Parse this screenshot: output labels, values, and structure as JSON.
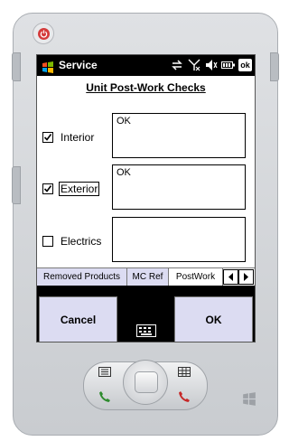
{
  "status_bar": {
    "app_title": "Service",
    "icons": [
      "windows-start-icon",
      "sync-arrows-icon",
      "no-signal-icon",
      "volume-muted-icon",
      "battery-icon",
      "ok-button"
    ],
    "ok_label": "ok"
  },
  "page": {
    "title": "Unit Post-Work Checks"
  },
  "checks": [
    {
      "label": "Interior",
      "checked": true,
      "note": "OK"
    },
    {
      "label": "Exterior",
      "checked": true,
      "note": "OK"
    },
    {
      "label": "Electrics",
      "checked": false,
      "note": ""
    }
  ],
  "tabs": [
    {
      "label": "Removed Products",
      "active": false
    },
    {
      "label": "MC Ref",
      "active": false
    },
    {
      "label": "PostWork",
      "active": true
    }
  ],
  "softkeys": {
    "left": "Cancel",
    "right": "OK"
  },
  "colors": {
    "softkey_bg": "#dcdcf2",
    "tab_bg": "#dcdcf2",
    "power_red": "#d43b3b",
    "call_green": "#2e8b2e",
    "end_red": "#c62828"
  }
}
